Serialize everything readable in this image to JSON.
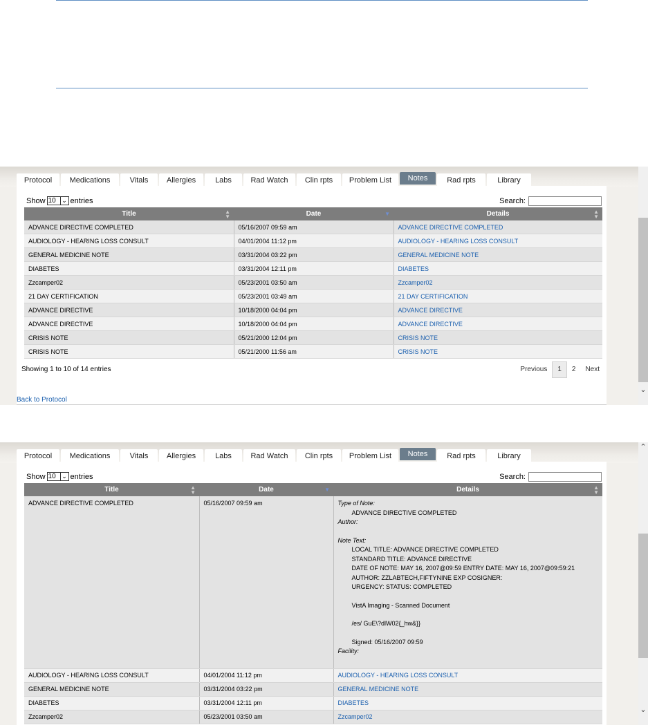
{
  "tabs": [
    "Protocol",
    "Medications",
    "Vitals",
    "Allergies",
    "Labs",
    "Rad Watch",
    "Clin rpts",
    "Problem List",
    "Notes",
    "Rad rpts",
    "Library"
  ],
  "active_tab": "Notes",
  "length_menu": {
    "prefix": "Show",
    "value": "10",
    "suffix": "entries"
  },
  "search_label": "Search:",
  "columns": [
    "Title",
    "Date",
    "Details"
  ],
  "rows": [
    {
      "title": "ADVANCE DIRECTIVE COMPLETED",
      "date": "05/16/2007 09:59 am",
      "details": "ADVANCE DIRECTIVE COMPLETED"
    },
    {
      "title": "AUDIOLOGY - HEARING LOSS CONSULT",
      "date": "04/01/2004 11:12 pm",
      "details": "AUDIOLOGY - HEARING LOSS CONSULT"
    },
    {
      "title": "GENERAL MEDICINE NOTE",
      "date": "03/31/2004 03:22 pm",
      "details": "GENERAL MEDICINE NOTE"
    },
    {
      "title": "DIABETES",
      "date": "03/31/2004 12:11 pm",
      "details": "DIABETES"
    },
    {
      "title": "Zzcamper02",
      "date": "05/23/2001 03:50 am",
      "details": "Zzcamper02"
    },
    {
      "title": "21 DAY CERTIFICATION",
      "date": "05/23/2001 03:49 am",
      "details": "21 DAY CERTIFICATION"
    },
    {
      "title": "ADVANCE DIRECTIVE",
      "date": "10/18/2000 04:04 pm",
      "details": "ADVANCE DIRECTIVE"
    },
    {
      "title": "ADVANCE DIRECTIVE",
      "date": "10/18/2000 04:04 pm",
      "details": "ADVANCE DIRECTIVE"
    },
    {
      "title": "CRISIS NOTE",
      "date": "05/21/2000 12:04 pm",
      "details": "CRISIS NOTE"
    },
    {
      "title": "CRISIS NOTE",
      "date": "05/21/2000 11:56 am",
      "details": "CRISIS NOTE"
    }
  ],
  "info": "Showing 1 to 10 of 14 entries",
  "pager": {
    "previous": "Previous",
    "pages": [
      "1",
      "2"
    ],
    "next": "Next"
  },
  "back_link": "Back to Protocol",
  "expanded_detail": {
    "type_label": "Type of Note:",
    "type_value": "ADVANCE DIRECTIVE COMPLETED",
    "author_label": "Author:",
    "note_text_label": "Note Text:",
    "lines": [
      "LOCAL TITLE: ADVANCE DIRECTIVE COMPLETED",
      "STANDARD TITLE: ADVANCE DIRECTIVE",
      "DATE OF NOTE: MAY 16, 2007@09:59 ENTRY DATE: MAY 16, 2007@09:59:21",
      "AUTHOR: ZZLABTECH,FIFTYNINE EXP COSIGNER:",
      "URGENCY: STATUS: COMPLETED"
    ],
    "imaging": "VistA Imaging - Scanned Document",
    "code": "/es/ GuE\\?dlW02{_hw&}}",
    "signed": "Signed: 05/16/2007 09:59",
    "facility_label": "Facility:"
  },
  "colors": {
    "link": "#1a5fae",
    "header": "#7d7d7d",
    "active_tab": "#6b7d8c"
  }
}
